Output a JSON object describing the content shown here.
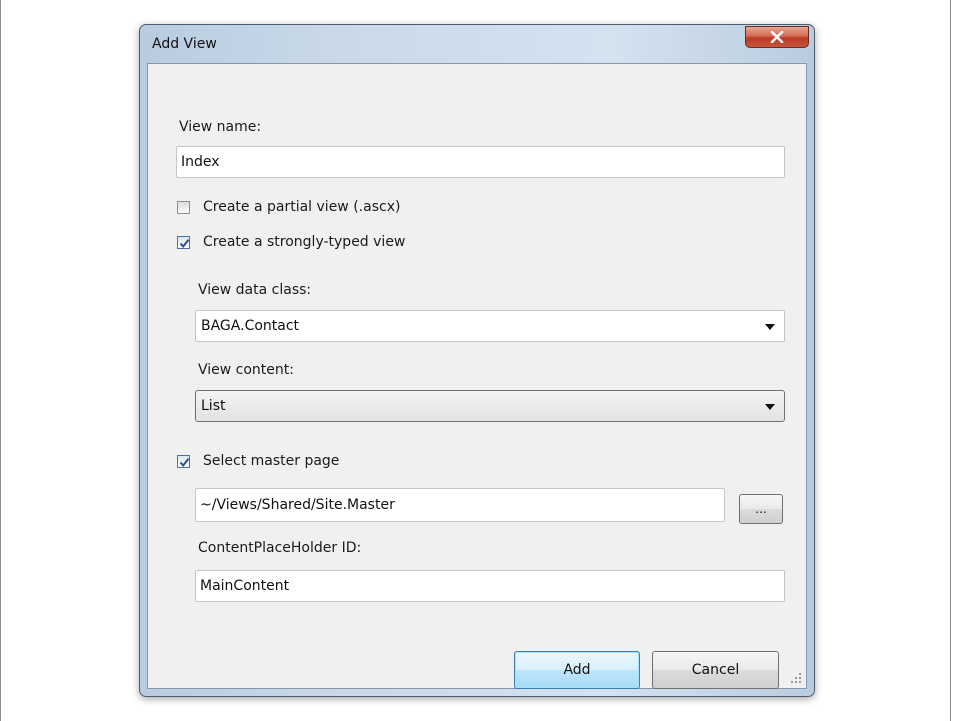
{
  "window": {
    "title": "Add View",
    "close_icon": "close-icon"
  },
  "form": {
    "view_name_label": "View name:",
    "view_name_value": "Index",
    "partial_view": {
      "label": "Create a partial view (.ascx)",
      "checked": false
    },
    "strongly_typed": {
      "label": "Create a strongly-typed view",
      "checked": true
    },
    "data_class_label": "View data class:",
    "data_class_value": "BAGA.Contact",
    "content_label": "View content:",
    "content_value": "List",
    "master_page": {
      "label": "Select master page",
      "checked": true
    },
    "master_page_path": "~/Views/Shared/Site.Master",
    "browse_label": "...",
    "placeholder_label": "ContentPlaceHolder ID:",
    "placeholder_value": "MainContent"
  },
  "buttons": {
    "add": "Add",
    "cancel": "Cancel"
  },
  "colors": {
    "close_button": "#c9553c",
    "default_button_border": "#3c7fb1",
    "checkmark": "#2a4d8f"
  }
}
